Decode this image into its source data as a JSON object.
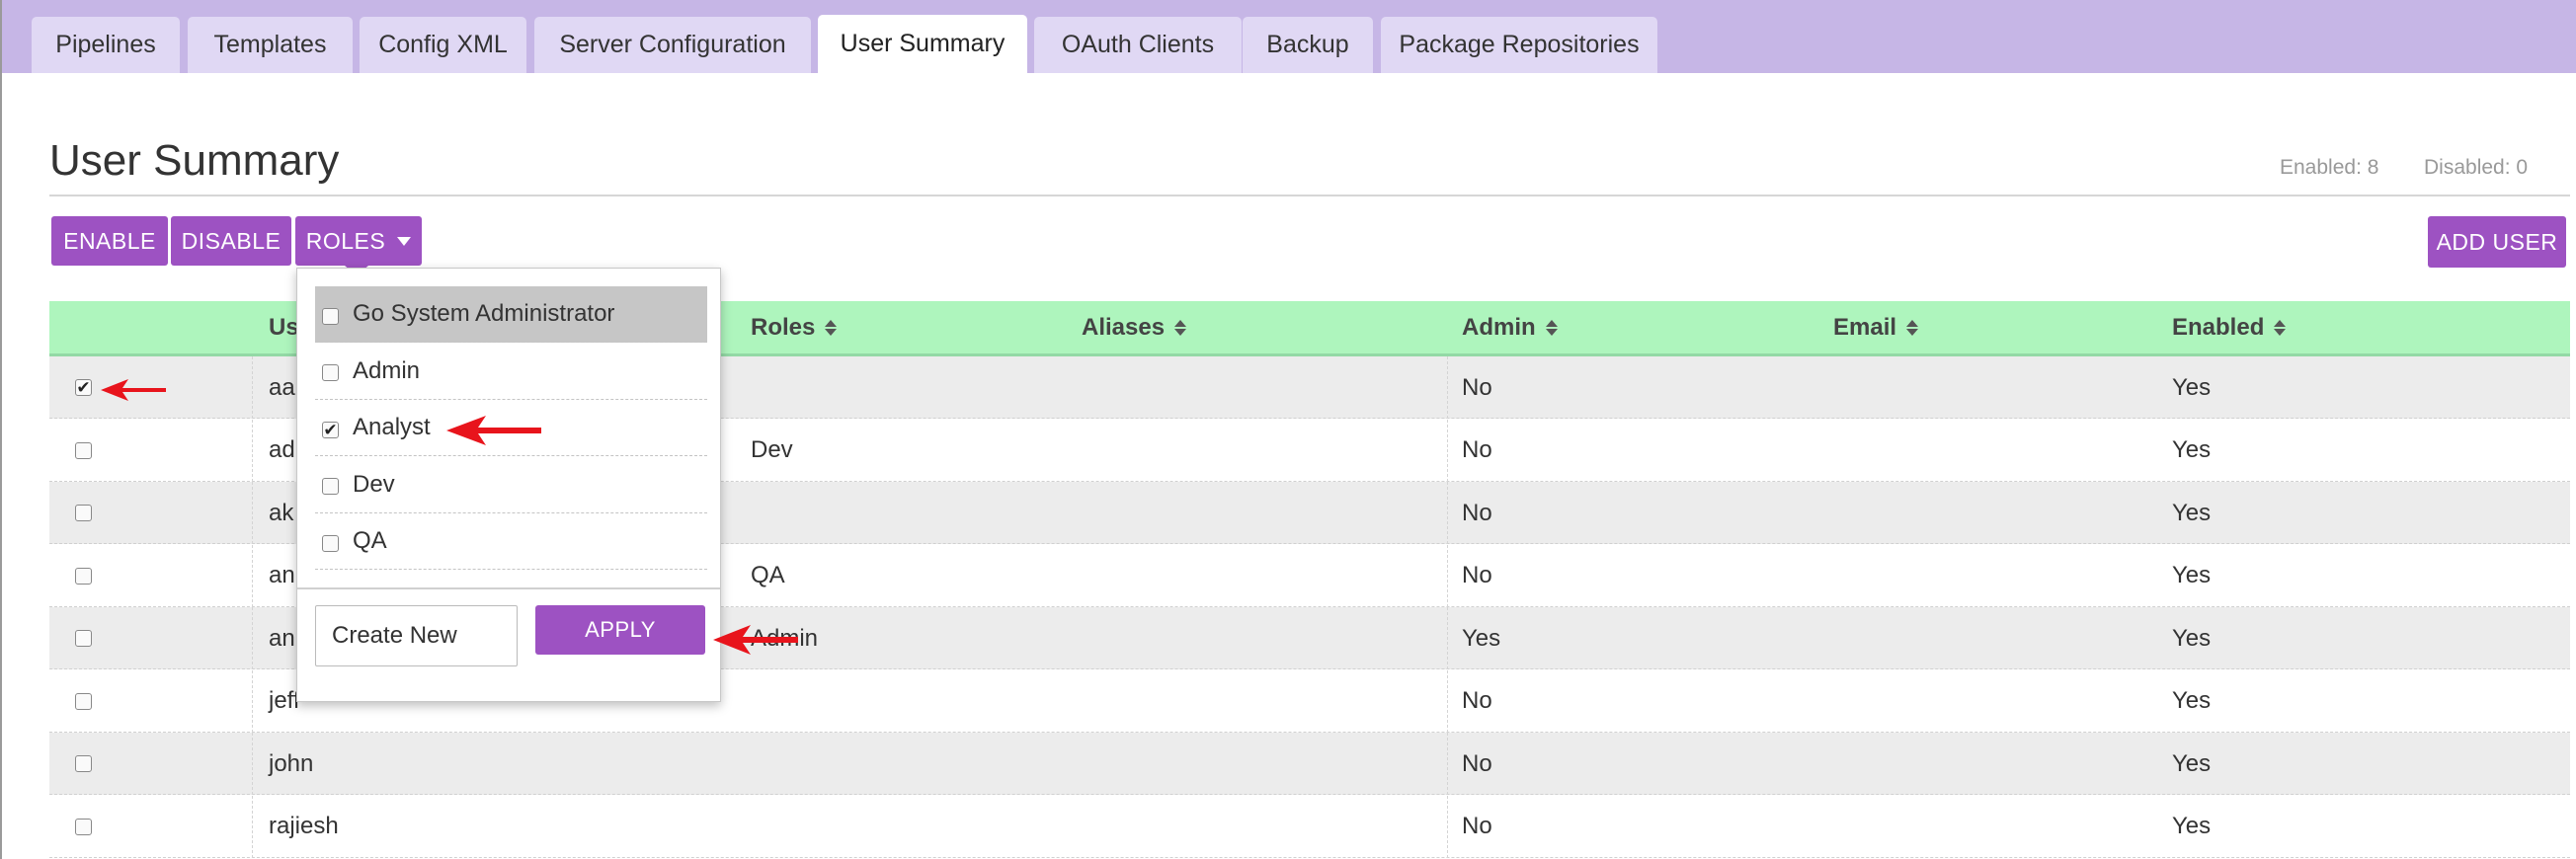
{
  "tabs": [
    {
      "label": "Pipelines",
      "active": false
    },
    {
      "label": "Templates",
      "active": false
    },
    {
      "label": "Config XML",
      "active": false
    },
    {
      "label": "Server Configuration",
      "active": false
    },
    {
      "label": "User Summary",
      "active": true
    },
    {
      "label": "OAuth Clients",
      "active": false
    },
    {
      "label": "Backup",
      "active": false
    },
    {
      "label": "Package Repositories",
      "active": false
    }
  ],
  "page": {
    "title": "User Summary",
    "enabled_count": "Enabled: 8",
    "disabled_count": "Disabled: 0"
  },
  "toolbar": {
    "enable_label": "ENABLE",
    "disable_label": "DISABLE",
    "roles_label": "ROLES",
    "add_user_label": "ADD USER"
  },
  "table": {
    "headers": {
      "username": "Us",
      "roles": "Roles",
      "aliases": "Aliases",
      "admin": "Admin",
      "email": "Email",
      "enabled": "Enabled"
    },
    "rows": [
      {
        "selected": true,
        "username": "aa",
        "roles": "",
        "aliases": "",
        "admin": "No",
        "email": "",
        "enabled": "Yes"
      },
      {
        "selected": false,
        "username": "ad",
        "roles": "Dev",
        "aliases": "",
        "admin": "No",
        "email": "",
        "enabled": "Yes"
      },
      {
        "selected": false,
        "username": "ak",
        "roles": "",
        "aliases": "",
        "admin": "No",
        "email": "",
        "enabled": "Yes"
      },
      {
        "selected": false,
        "username": "an",
        "roles": "QA",
        "aliases": "",
        "admin": "No",
        "email": "",
        "enabled": "Yes"
      },
      {
        "selected": false,
        "username": "an",
        "roles": "Admin",
        "aliases": "",
        "admin": "Yes",
        "email": "",
        "enabled": "Yes"
      },
      {
        "selected": false,
        "username": "jeff",
        "roles": "",
        "aliases": "",
        "admin": "No",
        "email": "",
        "enabled": "Yes"
      },
      {
        "selected": false,
        "username": "john",
        "roles": "",
        "aliases": "",
        "admin": "No",
        "email": "",
        "enabled": "Yes"
      },
      {
        "selected": false,
        "username": "rajiesh",
        "roles": "",
        "aliases": "",
        "admin": "No",
        "email": "",
        "enabled": "Yes"
      }
    ]
  },
  "roles_dropdown": {
    "items": [
      {
        "label": "Go System Administrator",
        "checked": false,
        "highlighted": true
      },
      {
        "label": "Admin",
        "checked": false,
        "highlighted": false
      },
      {
        "label": "Analyst",
        "checked": true,
        "highlighted": false
      },
      {
        "label": "Dev",
        "checked": false,
        "highlighted": false
      },
      {
        "label": "QA",
        "checked": false,
        "highlighted": false
      }
    ],
    "new_role_value": "Create New",
    "apply_label": "APPLY"
  },
  "colors": {
    "tabbar": "#c6b6e6",
    "tab": "#e0d8f4",
    "button": "#9d52c2",
    "table_header": "#aef5bd",
    "annotation_arrow": "#e8141c"
  }
}
